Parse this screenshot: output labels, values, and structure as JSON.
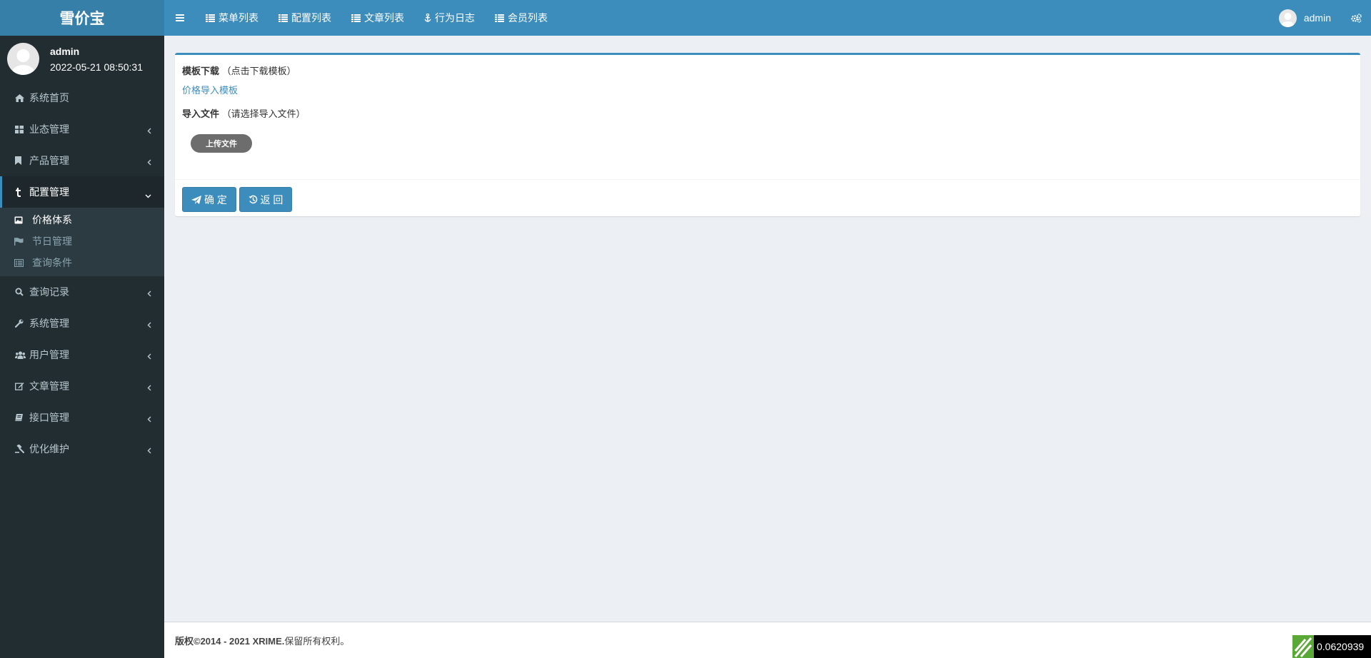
{
  "app": {
    "title": "雪价宝"
  },
  "topnav": {
    "items": [
      {
        "label": "菜单列表",
        "icon": "list-icon"
      },
      {
        "label": "配置列表",
        "icon": "list-icon"
      },
      {
        "label": "文章列表",
        "icon": "list-icon"
      },
      {
        "label": "行为日志",
        "icon": "anchor-icon"
      },
      {
        "label": "会员列表",
        "icon": "list-icon"
      }
    ],
    "user": "admin"
  },
  "sidebar": {
    "user": {
      "name": "admin",
      "time": "2022-05-21 08:50:31"
    },
    "items": [
      {
        "label": "系统首页"
      },
      {
        "label": "业态管理"
      },
      {
        "label": "产品管理"
      },
      {
        "label": "配置管理"
      },
      {
        "label": "查询记录"
      },
      {
        "label": "系统管理"
      },
      {
        "label": "用户管理"
      },
      {
        "label": "文章管理"
      },
      {
        "label": "接口管理"
      },
      {
        "label": "优化维护"
      }
    ],
    "submenu": [
      {
        "label": "价格体系"
      },
      {
        "label": "节日管理"
      },
      {
        "label": "查询条件"
      }
    ]
  },
  "form": {
    "download_label": "模板下载",
    "download_hint": "（点击下载模板）",
    "download_link": "价格导入模板",
    "import_label": "导入文件",
    "import_hint": "（请选择导入文件）",
    "upload_button": "上传文件",
    "confirm_button": "确 定",
    "back_button": "返 回"
  },
  "footer": {
    "copyright": "版权©2014 - 2021 XRIME.",
    "rights": " 保留所有权利。"
  },
  "speed": "0.0620939",
  "colors": {
    "header": "#3c8dbc",
    "logo": "#367fa9",
    "sidebar": "#222d32"
  }
}
